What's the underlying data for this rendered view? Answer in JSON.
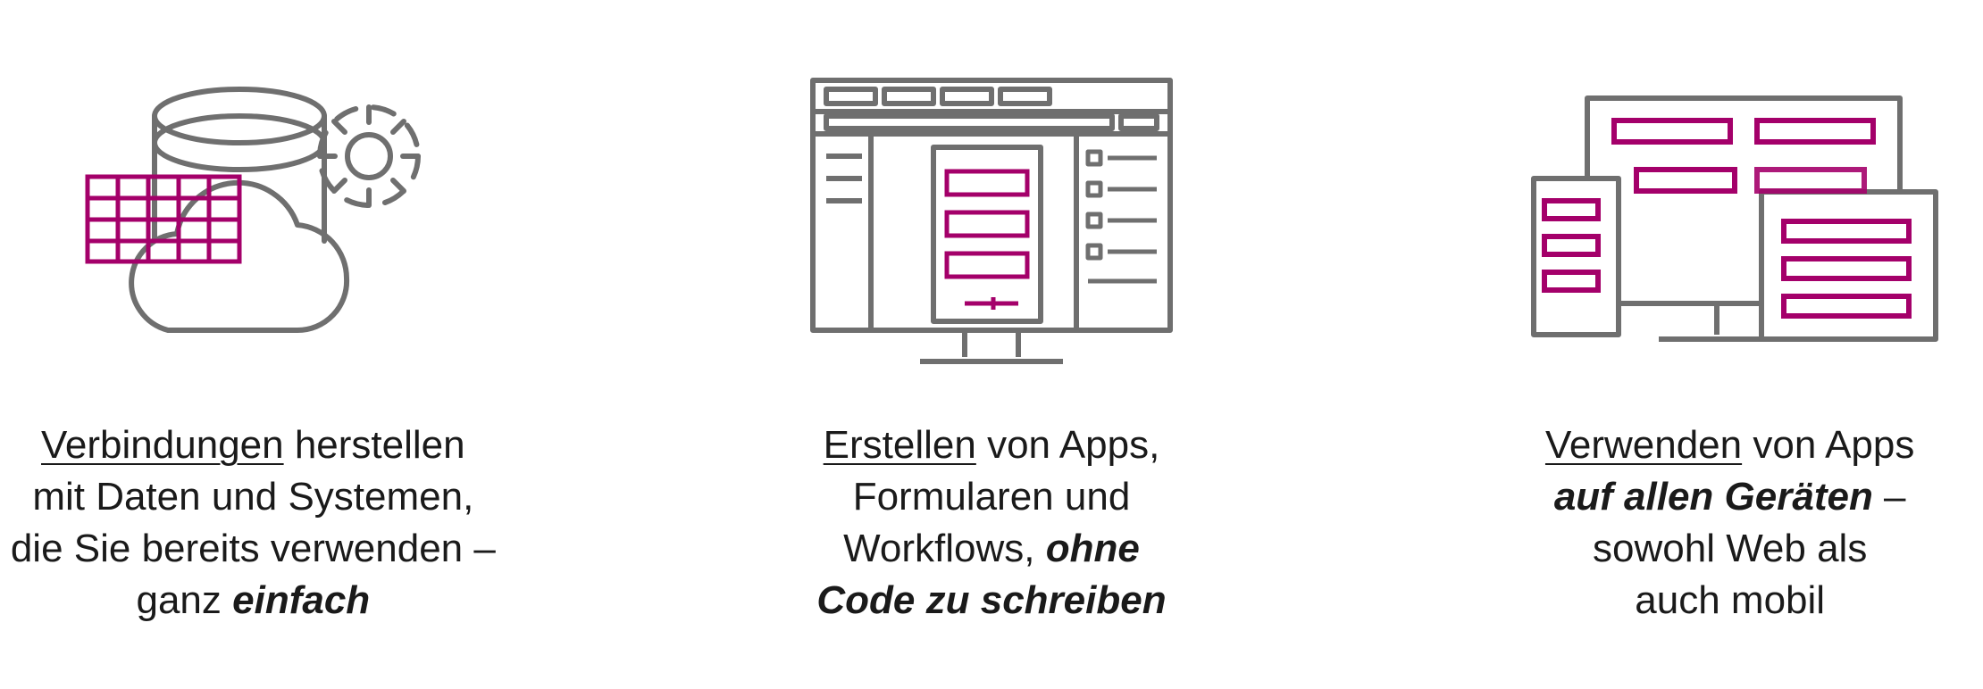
{
  "accent": "#a4006a",
  "stroke": "#6f6f6f",
  "columns": [
    {
      "id": "connect",
      "icon": "data-cloud-gear",
      "lead": "Verbindungen",
      "part1": " herstellen",
      "line2": "mit Daten und Systemen,",
      "line3a": "die Sie bereits verwenden –",
      "line4a": "ganz ",
      "line4em": "einfach"
    },
    {
      "id": "create",
      "icon": "app-designer",
      "lead": "Erstellen",
      "part1": " von Apps,",
      "line2": "Formularen und",
      "line3a": "Workflows, ",
      "line3em": "ohne",
      "line4em": "Code zu schreiben"
    },
    {
      "id": "use",
      "icon": "multi-device",
      "lead": "Verwenden",
      "part1": " von Apps",
      "line2em": "auf allen Geräten",
      "line2tail": " –",
      "line3a": "sowohl Web als",
      "line4a": "auch mobil"
    }
  ]
}
